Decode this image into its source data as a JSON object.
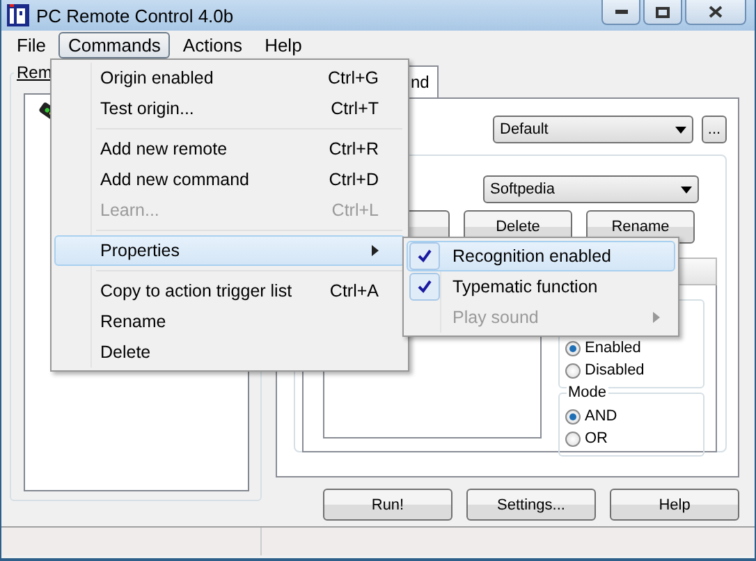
{
  "window": {
    "title": "PC Remote Control 4.0b"
  },
  "menu_bar": [
    {
      "label": "File",
      "selected": false
    },
    {
      "label": "Commands",
      "selected": true
    },
    {
      "label": "Actions",
      "selected": false
    },
    {
      "label": "Help",
      "selected": false
    }
  ],
  "remotes_panel": {
    "label": "Rem"
  },
  "tabs": [
    {
      "label": "nd",
      "selected": true
    }
  ],
  "profile_select": {
    "value": "Default"
  },
  "browse_button": "...",
  "remote_select": {
    "value": "Softpedia"
  },
  "remote_buttons": [
    "Delete",
    "Rename"
  ],
  "recognition": {
    "options": [
      {
        "label": "Enabled",
        "selected": true
      },
      {
        "label": "Disabled",
        "selected": false
      }
    ]
  },
  "mode": {
    "label": "Mode",
    "options": [
      {
        "label": "AND",
        "selected": true
      },
      {
        "label": "OR",
        "selected": false
      }
    ]
  },
  "footer_buttons": [
    "Run!",
    "Settings...",
    "Help"
  ],
  "commands_menu": {
    "items": [
      {
        "kind": "item",
        "label": "Origin enabled",
        "shortcut": "Ctrl+G",
        "disabled": false
      },
      {
        "kind": "item",
        "label": "Test origin...",
        "shortcut": "Ctrl+T",
        "disabled": false
      },
      {
        "kind": "separator"
      },
      {
        "kind": "item",
        "label": "Add new remote",
        "shortcut": "Ctrl+R",
        "disabled": false
      },
      {
        "kind": "item",
        "label": "Add new command",
        "shortcut": "Ctrl+D",
        "disabled": false
      },
      {
        "kind": "item",
        "label": "Learn...",
        "shortcut": "Ctrl+L",
        "disabled": true
      },
      {
        "kind": "separator"
      },
      {
        "kind": "submenu",
        "label": "Properties",
        "selected": true
      },
      {
        "kind": "separator"
      },
      {
        "kind": "item",
        "label": "Copy to action trigger list",
        "shortcut": "Ctrl+A",
        "disabled": false
      },
      {
        "kind": "item",
        "label": "Rename",
        "disabled": false
      },
      {
        "kind": "item",
        "label": "Delete",
        "disabled": false
      }
    ]
  },
  "properties_submenu": {
    "items": [
      {
        "label": "Recognition enabled",
        "checked": true,
        "disabled": false,
        "selected": true,
        "submenu": false
      },
      {
        "label": "Typematic function",
        "checked": true,
        "disabled": false,
        "selected": false,
        "submenu": false
      },
      {
        "label": "Play sound",
        "checked": false,
        "disabled": true,
        "selected": false,
        "submenu": true
      }
    ]
  }
}
